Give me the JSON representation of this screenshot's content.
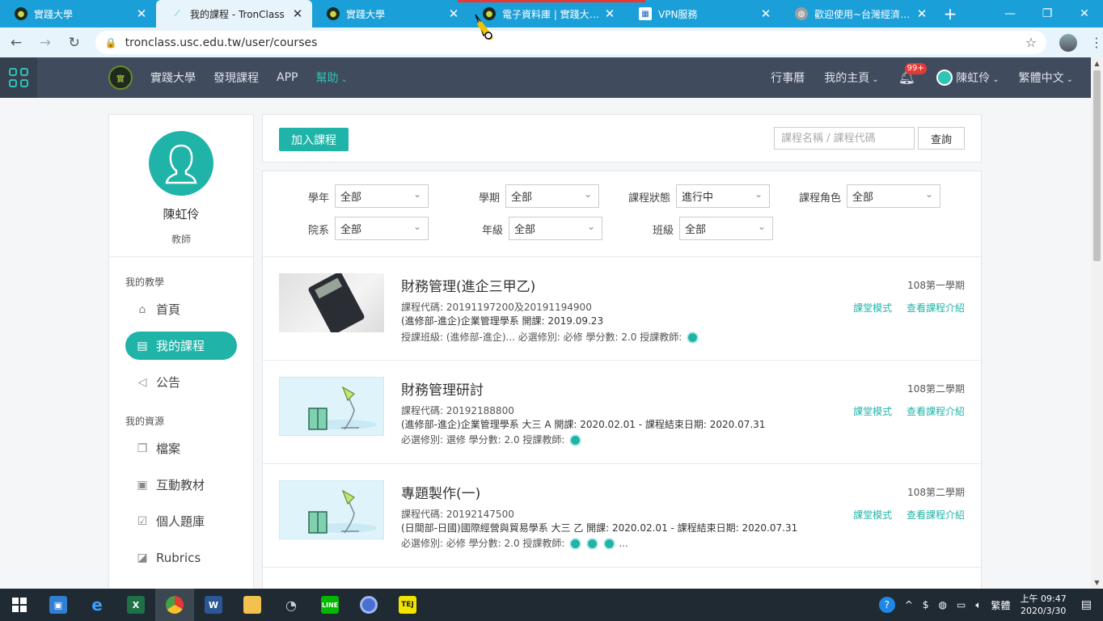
{
  "browser": {
    "tabs": [
      {
        "title": "實踐大學",
        "active": false
      },
      {
        "title": "我的課程 - TronClass",
        "active": true
      },
      {
        "title": "實踐大學",
        "active": false
      },
      {
        "title": "電子資料庫 | 實踐大學...",
        "active": false
      },
      {
        "title": "VPN服務",
        "active": false
      },
      {
        "title": "歡迎使用~台灣經濟新報",
        "active": false
      }
    ],
    "url": "tronclass.usc.edu.tw/user/courses"
  },
  "appnav": {
    "links": [
      "實踐大學",
      "發現課程",
      "APP",
      "幫助"
    ],
    "calendar": "行事曆",
    "my_home": "我的主頁",
    "badge": "99+",
    "user": "陳虹伶",
    "language": "繁體中文"
  },
  "sidebar": {
    "name": "陳虹伶",
    "role": "教師",
    "teaching_heading": "我的教學",
    "teaching_items": [
      "首頁",
      "我的課程",
      "公告"
    ],
    "resources_heading": "我的資源",
    "resource_items": [
      "檔案",
      "互動教材",
      "個人題庫",
      "Rubrics"
    ]
  },
  "toolbar": {
    "add_course": "加入課程",
    "search_placeholder": "課程名稱 / 課程代碼",
    "search_button": "查詢"
  },
  "filters": [
    {
      "label": "學年",
      "value": "全部"
    },
    {
      "label": "學期",
      "value": "全部"
    },
    {
      "label": "課程狀態",
      "value": "進行中"
    },
    {
      "label": "課程角色",
      "value": "全部"
    },
    {
      "label": "院系",
      "value": "全部"
    },
    {
      "label": "年級",
      "value": "全部"
    },
    {
      "label": "班級",
      "value": "全部"
    }
  ],
  "courses": [
    {
      "title": "財務管理(進企三甲乙)",
      "line1": "課程代碼: 20191197200及20191194900",
      "line2": "(進修部-進企)企業管理學系   開課: 2019.09.23",
      "line3": "授課班級: (進修部-進企)...       必選修別: 必修      學分數: 2.0       授課教師:",
      "term": "108第一學期",
      "link1": "課堂模式",
      "link2": "查看課程介紹"
    },
    {
      "title": "財務管理研討",
      "line1": "課程代碼: 20192188800",
      "line2": "(進修部-進企)企業管理學系   大三   A   開課: 2020.02.01   -  課程結束日期: 2020.07.31",
      "line3": "必選修別: 選修      學分數: 2.0      授課教師:",
      "term": "108第二學期",
      "link1": "課堂模式",
      "link2": "查看課程介紹"
    },
    {
      "title": "專題製作(一)",
      "line1": "課程代碼: 20192147500",
      "line2": "(日間部-日國)國際經營與貿易學系   大三   乙   開課: 2020.02.01   -  課程結束日期: 2020.07.31",
      "line3": "必選修別: 必修      學分數: 2.0      授課教師:",
      "term": "108第二學期",
      "link1": "課堂模式",
      "link2": "查看課程介紹",
      "more": "..."
    }
  ],
  "taskbar": {
    "ime": "繁體",
    "time": "上午 09:47",
    "date": "2020/3/30"
  }
}
